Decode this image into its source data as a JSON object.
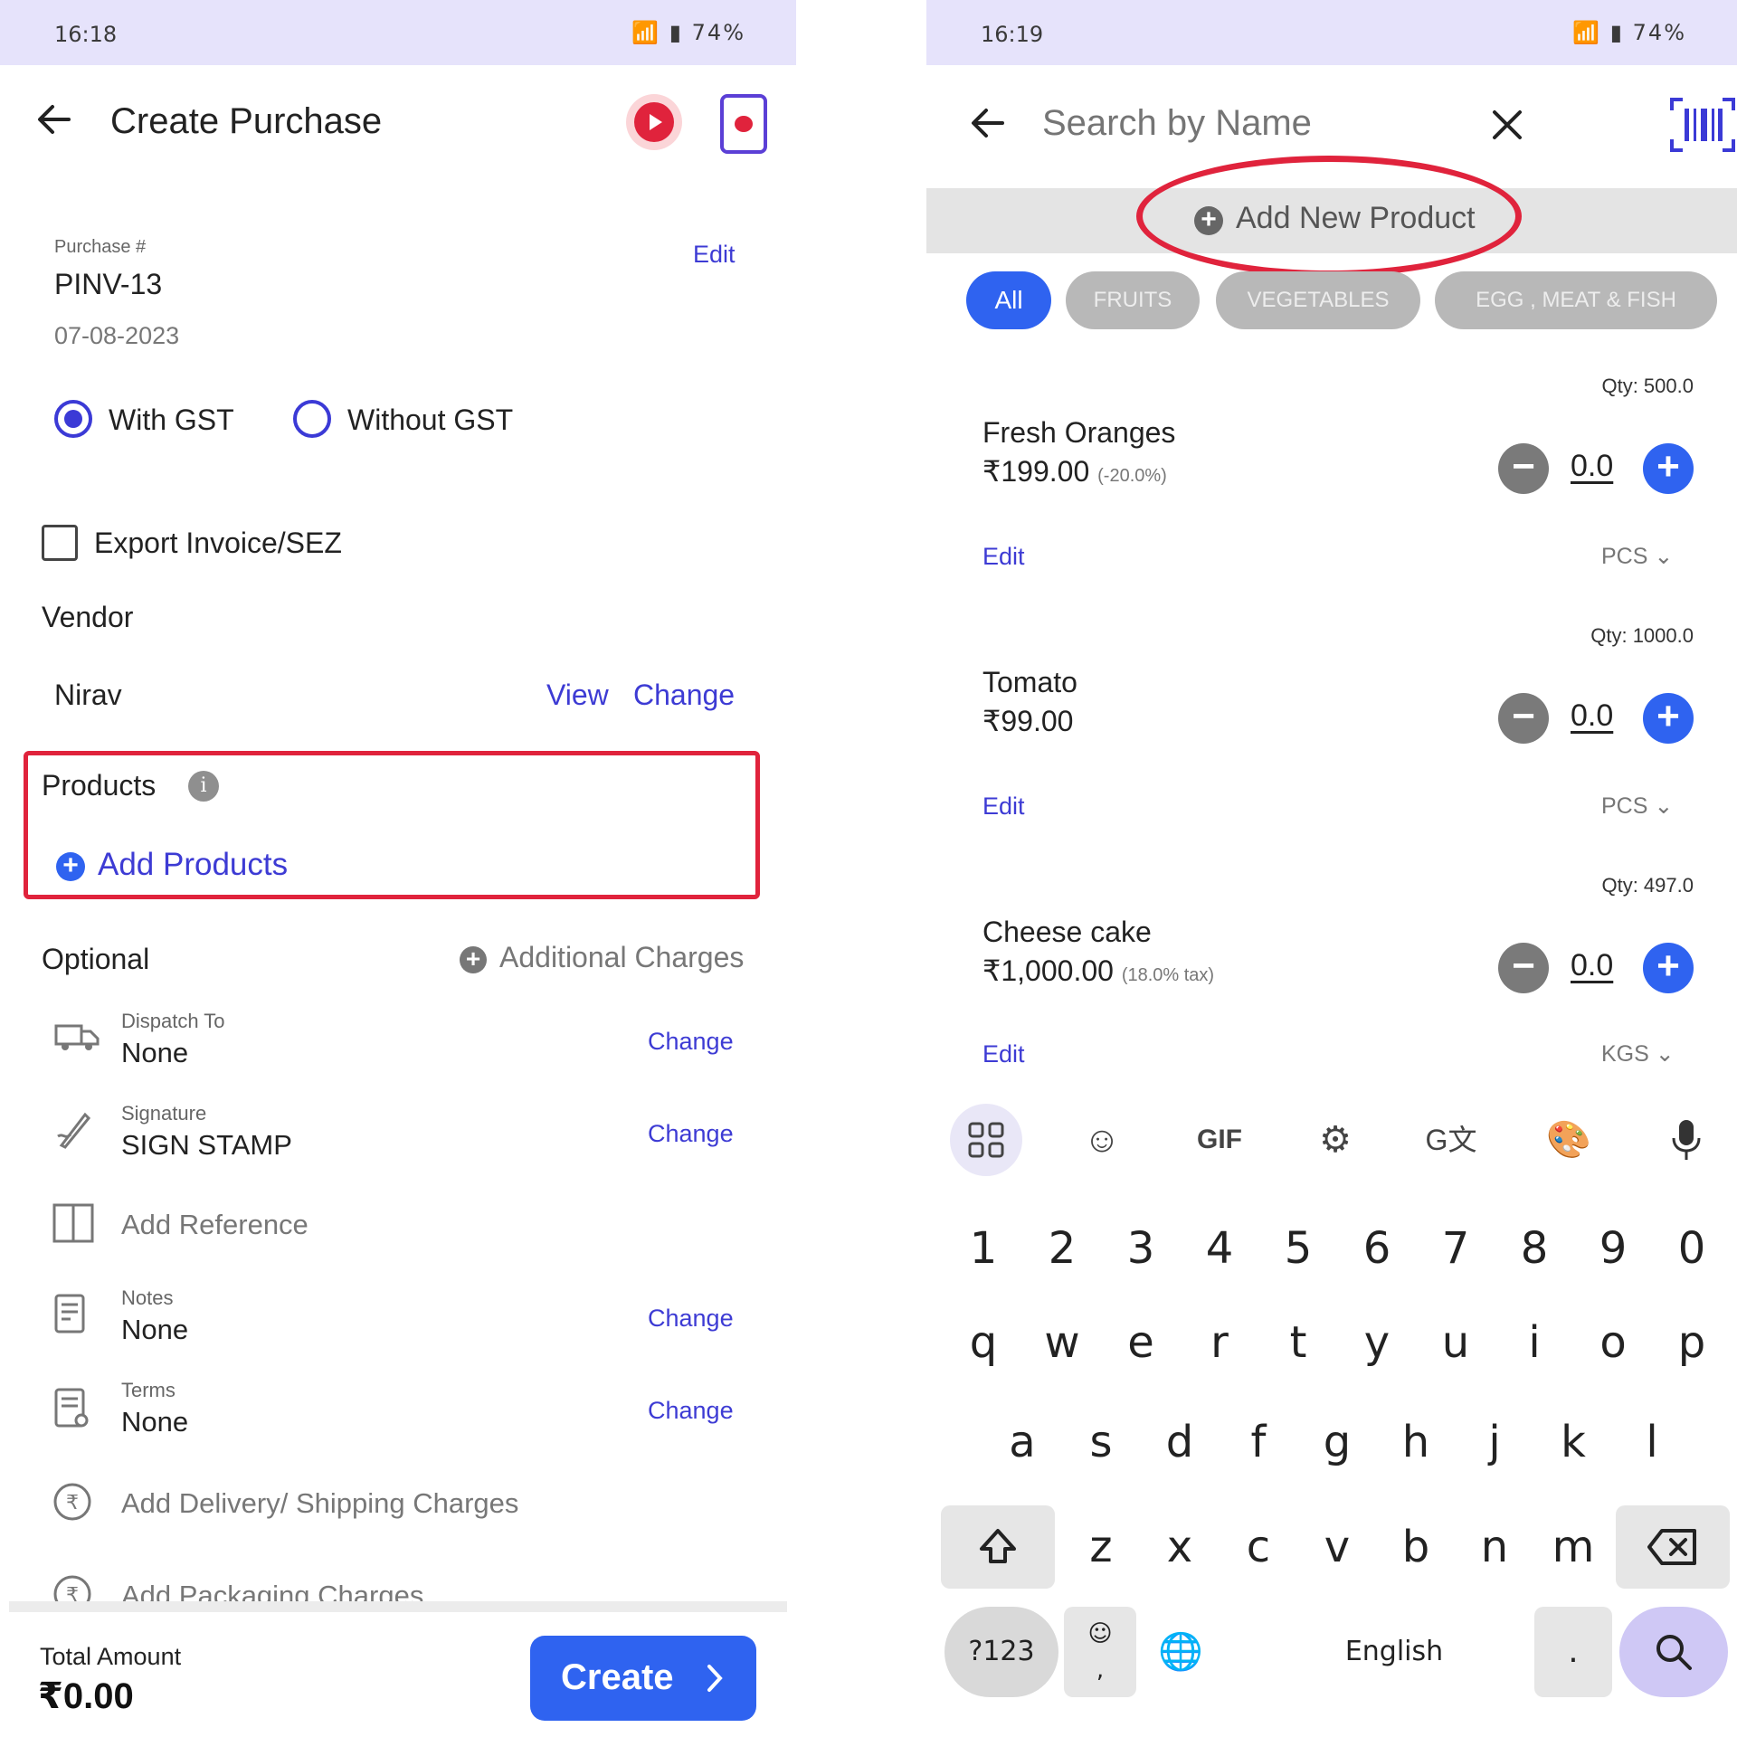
{
  "left": {
    "status": {
      "time": "16:18",
      "battery": "74%"
    },
    "header": {
      "title": "Create Purchase"
    },
    "purchase": {
      "label": "Purchase #",
      "number": "PINV-13",
      "date": "07-08-2023",
      "edit": "Edit"
    },
    "gst": {
      "with": "With GST",
      "without": "Without GST"
    },
    "export": {
      "label": "Export Invoice/SEZ"
    },
    "vendor": {
      "heading": "Vendor",
      "name": "Nirav",
      "view": "View",
      "change": "Change"
    },
    "products": {
      "heading": "Products",
      "add": "Add Products"
    },
    "optional": {
      "heading": "Optional",
      "additional": "Additional Charges",
      "dispatch": {
        "label": "Dispatch To",
        "value": "None",
        "action": "Change"
      },
      "signature": {
        "label": "Signature",
        "value": "SIGN STAMP",
        "action": "Change"
      },
      "reference": "Add Reference",
      "notes": {
        "label": "Notes",
        "value": "None",
        "action": "Change"
      },
      "terms": {
        "label": "Terms",
        "value": "None",
        "action": "Change"
      },
      "delivery": "Add Delivery/ Shipping Charges",
      "packaging": "Add Packaging Charges"
    },
    "footer": {
      "total_label": "Total Amount",
      "total": "₹0.00",
      "create": "Create"
    }
  },
  "right": {
    "status": {
      "time": "16:19",
      "battery": "74%"
    },
    "search": {
      "placeholder": "Search by Name"
    },
    "add_new": "Add New Product",
    "categories": [
      "All",
      "FRUITS",
      "VEGETABLES",
      "EGG , MEAT & FISH"
    ],
    "products": [
      {
        "qty_label": "Qty: 500.0",
        "name": "Fresh Oranges",
        "price": "₹199.00",
        "tax": "(-20.0%)",
        "qty": "0.0",
        "edit": "Edit",
        "unit": "PCS"
      },
      {
        "qty_label": "Qty: 1000.0",
        "name": "Tomato",
        "price": "₹99.00",
        "tax": "",
        "qty": "0.0",
        "edit": "Edit",
        "unit": "PCS"
      },
      {
        "qty_label": "Qty: 497.0",
        "name": "Cheese cake",
        "price": "₹1,000.00",
        "tax": "(18.0% tax)",
        "qty": "0.0",
        "edit": "Edit",
        "unit": "KGS"
      }
    ],
    "keyboard": {
      "tools": [
        "apps-icon",
        "sticker-icon",
        "GIF",
        "settings-icon",
        "translate-icon",
        "palette-icon",
        "mic-icon"
      ],
      "numbers": [
        "1",
        "2",
        "3",
        "4",
        "5",
        "6",
        "7",
        "8",
        "9",
        "0"
      ],
      "row1": [
        "q",
        "w",
        "e",
        "r",
        "t",
        "y",
        "u",
        "i",
        "o",
        "p"
      ],
      "row2": [
        "a",
        "s",
        "d",
        "f",
        "g",
        "h",
        "j",
        "k",
        "l"
      ],
      "row3": [
        "z",
        "x",
        "c",
        "v",
        "b",
        "n",
        "m"
      ],
      "symbols": "?123",
      "space": "English",
      "period": "."
    }
  },
  "colors": {
    "accent": "#3b3ad6",
    "primary_button": "#2f63f0",
    "highlight": "#e0233c",
    "status_bar": "#e6e3fb"
  }
}
